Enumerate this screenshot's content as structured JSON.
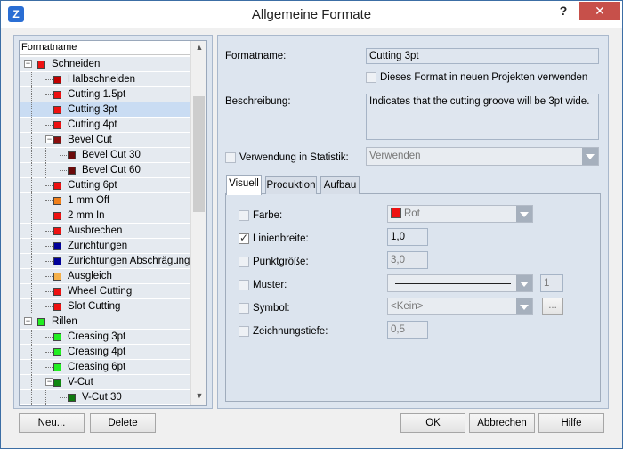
{
  "window": {
    "title": "Allgemeine Formate",
    "help_label": "?",
    "close_label": "✕",
    "app_icon_label": "Z"
  },
  "tree": {
    "header": "Formatname",
    "rows": [
      {
        "label": "Schneiden",
        "color": "#ee1111",
        "level": 0,
        "expander": "−"
      },
      {
        "label": "Halbschneiden",
        "color": "#c00000",
        "level": 1
      },
      {
        "label": "Cutting 1.5pt",
        "color": "#ee1111",
        "level": 1
      },
      {
        "label": "Cutting 3pt",
        "color": "#ee1111",
        "level": 1,
        "selected": true
      },
      {
        "label": "Cutting 4pt",
        "color": "#ee1111",
        "level": 1
      },
      {
        "label": "Bevel Cut",
        "color": "#8b0f0f",
        "level": 1,
        "expander": "−"
      },
      {
        "label": "Bevel Cut 30",
        "color": "#6b0a0a",
        "level": 2
      },
      {
        "label": "Bevel Cut 60",
        "color": "#6b0a0a",
        "level": 2
      },
      {
        "label": "Cutting 6pt",
        "color": "#ee1111",
        "level": 1
      },
      {
        "label": "1 mm Off",
        "color": "#f07f1a",
        "level": 1
      },
      {
        "label": "2 mm In",
        "color": "#ee1111",
        "level": 1
      },
      {
        "label": "Ausbrechen",
        "color": "#ee1111",
        "level": 1
      },
      {
        "label": "Zurichtungen",
        "color": "#000099",
        "level": 1
      },
      {
        "label": "Zurichtungen Abschrägung",
        "color": "#000099",
        "level": 1
      },
      {
        "label": "Ausgleich",
        "color": "#f5b04a",
        "level": 1
      },
      {
        "label": "Wheel Cutting",
        "color": "#ee1111",
        "level": 1
      },
      {
        "label": "Slot Cutting",
        "color": "#ee1111",
        "level": 1
      },
      {
        "label": "Rillen",
        "color": "#22ee22",
        "level": 0,
        "expander": "−"
      },
      {
        "label": "Creasing 3pt",
        "color": "#22ee22",
        "level": 1
      },
      {
        "label": "Creasing 4pt",
        "color": "#22ee22",
        "level": 1
      },
      {
        "label": "Creasing 6pt",
        "color": "#22ee22",
        "level": 1
      },
      {
        "label": "V-Cut",
        "color": "#118811",
        "level": 1,
        "expander": "−"
      },
      {
        "label": "V-Cut 30",
        "color": "#0f7a0f",
        "level": 2
      }
    ]
  },
  "form": {
    "formatname_label": "Formatname:",
    "formatname_value": "Cutting 3pt",
    "new_projects_label": "Dieses Format in neuen Projekten verwenden",
    "beschreibung_label": "Beschreibung:",
    "beschreibung_value": "Indicates that the cutting groove will be 3pt wide.",
    "statistik_label": "Verwendung in Statistik:",
    "statistik_value": "Verwenden"
  },
  "tabs": [
    "Visuell",
    "Produktion",
    "Aufbau"
  ],
  "visuell": {
    "farbe_label": "Farbe:",
    "farbe_value": "Rot",
    "farbe_color": "#ee1111",
    "linienbreite_label": "Linienbreite:",
    "linienbreite_value": "1,0",
    "punktgroesse_label": "Punktgröße:",
    "punktgroesse_value": "3,0",
    "muster_label": "Muster:",
    "muster_count": "1",
    "symbol_label": "Symbol:",
    "symbol_value": "<Kein>",
    "symbol_more": "...",
    "zeichnungstiefe_label": "Zeichnungstiefe:",
    "zeichnungstiefe_value": "0,5"
  },
  "buttons": {
    "neu": "Neu...",
    "delete": "Delete",
    "ok": "OK",
    "abbrechen": "Abbrechen",
    "hilfe": "Hilfe"
  }
}
